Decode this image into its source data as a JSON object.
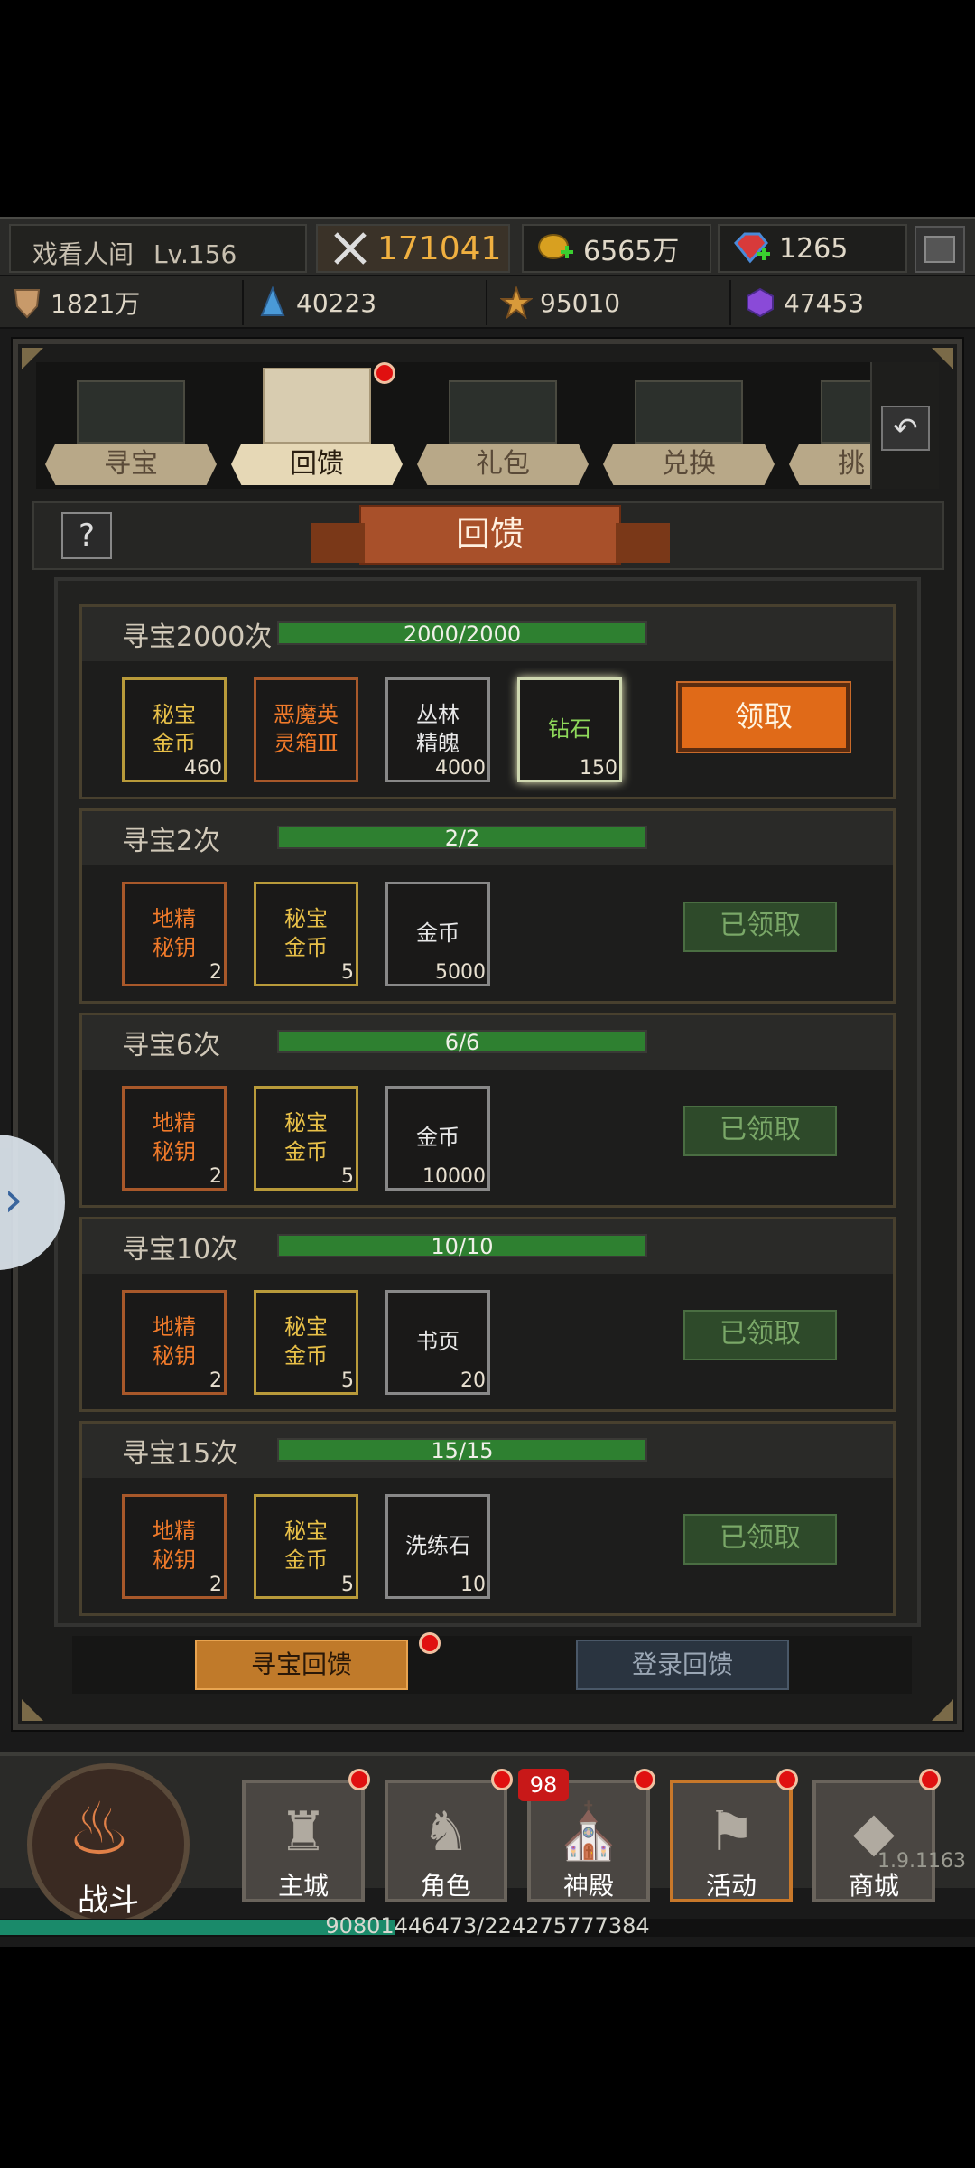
{
  "player": {
    "name": "戏看人间",
    "level": "Lv.156"
  },
  "resources": {
    "power": "171041",
    "gold": "6565万",
    "gems": "1265",
    "wood": "1821万",
    "crystal": "40223",
    "star": "95010",
    "purple": "47453"
  },
  "tabs": [
    {
      "label": "寻宝"
    },
    {
      "label": "回馈"
    },
    {
      "label": "礼包"
    },
    {
      "label": "兑换"
    },
    {
      "label": "挑"
    }
  ],
  "page_title": "回馈",
  "help_label": "?",
  "sections": [
    {
      "title": "寻宝2000次",
      "progress": "2000/2000",
      "fraction": 1.0,
      "button": "领取",
      "claimed": false,
      "items": [
        {
          "name": "秘宝\n金币",
          "count": "460",
          "q": "gold-q"
        },
        {
          "name": "恶魔英\n灵箱Ⅲ",
          "count": "",
          "q": "orange-q"
        },
        {
          "name": "丛林\n精魄",
          "count": "4000",
          "q": "white-q"
        },
        {
          "name": "钻石",
          "count": "150",
          "q": "green-q"
        }
      ]
    },
    {
      "title": "寻宝2次",
      "progress": "2/2",
      "fraction": 1.0,
      "button": "已领取",
      "claimed": true,
      "items": [
        {
          "name": "地精\n秘钥",
          "count": "2",
          "q": "orange-q"
        },
        {
          "name": "秘宝\n金币",
          "count": "5",
          "q": "gold-q"
        },
        {
          "name": "金币",
          "count": "5000",
          "q": "white-q"
        }
      ]
    },
    {
      "title": "寻宝6次",
      "progress": "6/6",
      "fraction": 1.0,
      "button": "已领取",
      "claimed": true,
      "items": [
        {
          "name": "地精\n秘钥",
          "count": "2",
          "q": "orange-q"
        },
        {
          "name": "秘宝\n金币",
          "count": "5",
          "q": "gold-q"
        },
        {
          "name": "金币",
          "count": "10000",
          "q": "white-q"
        }
      ]
    },
    {
      "title": "寻宝10次",
      "progress": "10/10",
      "fraction": 1.0,
      "button": "已领取",
      "claimed": true,
      "items": [
        {
          "name": "地精\n秘钥",
          "count": "2",
          "q": "orange-q"
        },
        {
          "name": "秘宝\n金币",
          "count": "5",
          "q": "gold-q"
        },
        {
          "name": "书页",
          "count": "20",
          "q": "white-q"
        }
      ]
    },
    {
      "title": "寻宝15次",
      "progress": "15/15",
      "fraction": 1.0,
      "button": "已领取",
      "claimed": true,
      "items": [
        {
          "name": "地精\n秘钥",
          "count": "2",
          "q": "orange-q"
        },
        {
          "name": "秘宝\n金币",
          "count": "5",
          "q": "gold-q"
        },
        {
          "name": "洗练石",
          "count": "10",
          "q": "white-q"
        }
      ]
    }
  ],
  "bottom_tabs": {
    "active": "寻宝回馈",
    "inactive": "登录回馈"
  },
  "nav": {
    "fight": "战斗",
    "items": [
      {
        "label": "主城",
        "icon": "castle-icon",
        "glyph": "♜"
      },
      {
        "label": "角色",
        "icon": "helmet-icon",
        "glyph": "♞"
      },
      {
        "label": "神殿",
        "icon": "temple-icon",
        "glyph": "⛪"
      },
      {
        "label": "活动",
        "icon": "banner-icon",
        "glyph": "⚑"
      },
      {
        "label": "商城",
        "icon": "diamond-icon",
        "glyph": "◆"
      }
    ],
    "badge": "98",
    "version": "1.9.1163"
  },
  "exp": {
    "text": "90801446473/224275777384",
    "fraction": 0.405
  },
  "colors": {
    "accent": "#e06a18",
    "progress": "#2e8030",
    "claimed": "#2e4a2a"
  }
}
